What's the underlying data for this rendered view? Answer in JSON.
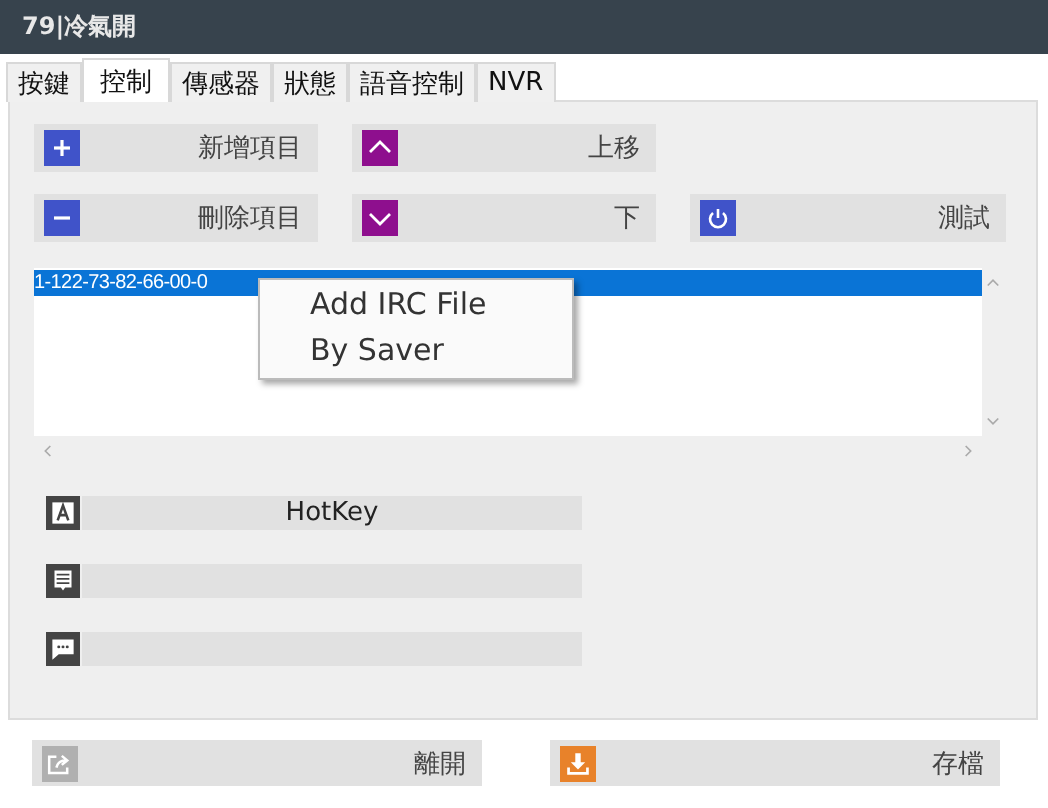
{
  "window": {
    "title": "79|冷氣開"
  },
  "tabs": [
    {
      "label": "按鍵",
      "selected": false
    },
    {
      "label": "控制",
      "selected": true
    },
    {
      "label": "傳感器",
      "selected": false
    },
    {
      "label": "狀態",
      "selected": false
    },
    {
      "label": "語音控制",
      "selected": false
    },
    {
      "label": "NVR",
      "selected": false
    }
  ],
  "actions": [
    {
      "label": "新增項目",
      "kind": "plus",
      "color": "#4053c9"
    },
    {
      "label": "上移",
      "kind": "up",
      "color": "#8e0f8e"
    },
    {
      "label": "刪除項目",
      "kind": "minus",
      "color": "#4053c9"
    },
    {
      "label": "下",
      "kind": "down",
      "color": "#8e0f8e"
    },
    {
      "label": "測試",
      "kind": "power",
      "color": "#4053c9"
    }
  ],
  "list": {
    "items": [
      {
        "text": "1-122-73-82-66-00-0",
        "selected": true
      }
    ]
  },
  "context_menu": {
    "items": [
      "Add IRC File",
      "By Saver"
    ]
  },
  "fields": [
    {
      "kind": "letter",
      "value": "HotKey"
    },
    {
      "kind": "note"
    },
    {
      "kind": "chat"
    }
  ],
  "footer_buttons": [
    {
      "label": "離開",
      "kind": "exit",
      "color": "#b0b0b0"
    },
    {
      "label": "存檔",
      "kind": "save",
      "color": "#e8822a"
    }
  ]
}
